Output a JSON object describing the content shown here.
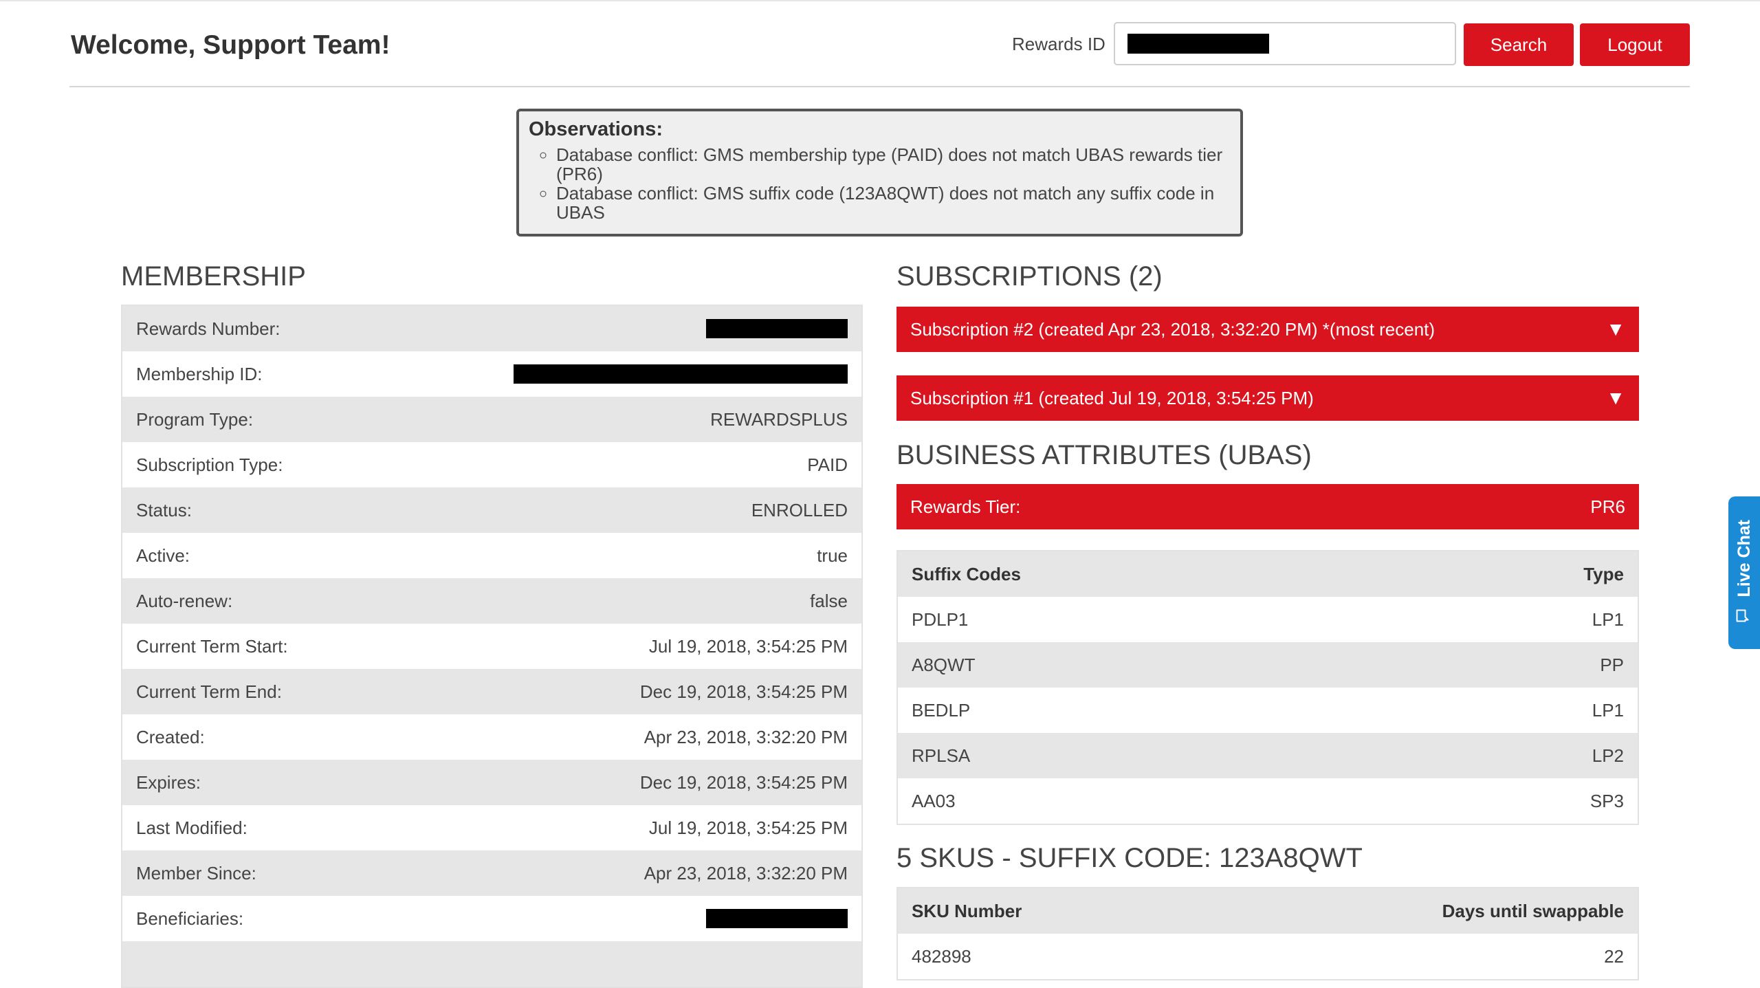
{
  "header": {
    "title": "Welcome, Support Team!",
    "rewards_id_label": "Rewards ID",
    "rewards_id_value": "",
    "search_label": "Search",
    "logout_label": "Logout"
  },
  "observations": {
    "title": "Observations:",
    "items": [
      "Database conflict: GMS membership type (PAID) does not match UBAS rewards tier (PR6)",
      "Database conflict: GMS suffix code (123A8QWT) does not match any suffix code in UBAS"
    ]
  },
  "membership": {
    "title": "MEMBERSHIP",
    "rows": [
      {
        "label": "Rewards Number:",
        "value": ""
      },
      {
        "label": "Membership ID:",
        "value": ""
      },
      {
        "label": "Program Type:",
        "value": "REWARDSPLUS"
      },
      {
        "label": "Subscription Type:",
        "value": "PAID"
      },
      {
        "label": "Status:",
        "value": "ENROLLED"
      },
      {
        "label": "Active:",
        "value": "true"
      },
      {
        "label": "Auto-renew:",
        "value": "false"
      },
      {
        "label": "Current Term Start:",
        "value": "Jul 19, 2018, 3:54:25 PM"
      },
      {
        "label": "Current Term End:",
        "value": "Dec 19, 2018, 3:54:25 PM"
      },
      {
        "label": "Created:",
        "value": "Apr 23, 2018, 3:32:20 PM"
      },
      {
        "label": "Expires:",
        "value": "Dec 19, 2018, 3:54:25 PM"
      },
      {
        "label": "Last Modified:",
        "value": "Jul 19, 2018, 3:54:25 PM"
      },
      {
        "label": "Member Since:",
        "value": "Apr 23, 2018, 3:32:20 PM"
      },
      {
        "label": "Beneficiaries:",
        "value": ""
      }
    ]
  },
  "subscriptions": {
    "title": "SUBSCRIPTIONS (2)",
    "items": [
      {
        "label": "Subscription #2 (created Apr 23, 2018, 3:32:20 PM) *(most recent)",
        "caret": "▼"
      },
      {
        "label": "Subscription #1 (created Jul 19, 2018, 3:54:25 PM)",
        "caret": "▼"
      }
    ]
  },
  "business": {
    "title": "BUSINESS ATTRIBUTES (UBAS)",
    "tier_label": "Rewards Tier:",
    "tier_value": "PR6",
    "suffix_header": {
      "code": "Suffix Codes",
      "type": "Type"
    },
    "suffix_rows": [
      {
        "code": "PDLP1",
        "type": "LP1"
      },
      {
        "code": "A8QWT",
        "type": "PP"
      },
      {
        "code": "BEDLP",
        "type": "LP1"
      },
      {
        "code": "RPLSA",
        "type": "LP2"
      },
      {
        "code": "AA03",
        "type": "SP3"
      }
    ]
  },
  "skus": {
    "title": "5 SKUS - SUFFIX CODE: 123A8QWT",
    "header": {
      "sku": "SKU Number",
      "days": "Days until swappable"
    },
    "rows": [
      {
        "sku": "482898",
        "days": "22"
      }
    ]
  },
  "live_chat": {
    "label": "Live Chat"
  },
  "colors": {
    "brand_red": "#d9141e",
    "chat_blue": "#1b8bd6",
    "row_gray": "#e6e6e6"
  }
}
